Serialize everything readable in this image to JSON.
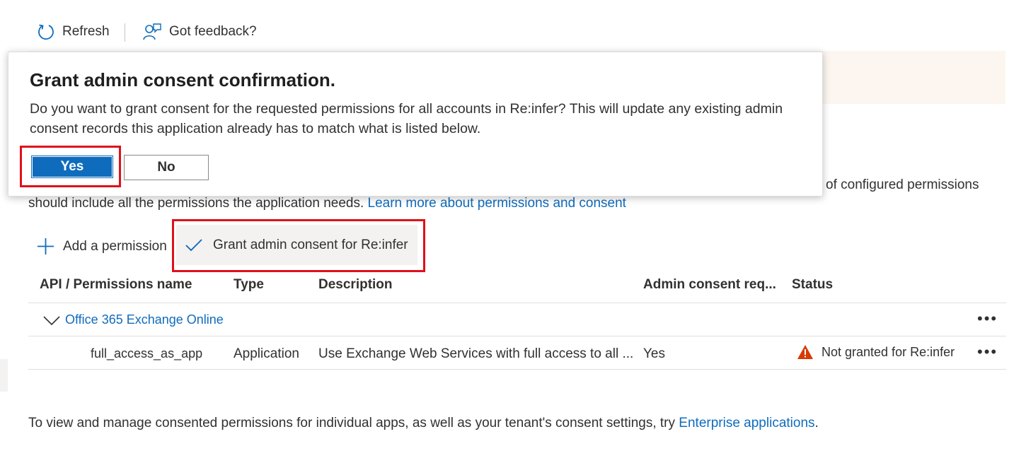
{
  "toolbar": {
    "refresh_label": "Refresh",
    "feedback_label": "Got feedback?"
  },
  "intro": {
    "line1_tail": "of configured permissions",
    "line2": "should include all the permissions the application needs.",
    "learn_more_link": "Learn more about permissions and consent"
  },
  "commands": {
    "add_permission_label": "Add a permission",
    "grant_consent_label": "Grant admin consent for Re:infer"
  },
  "table": {
    "columns": [
      "API / Permissions name",
      "Type",
      "Description",
      "Admin consent req...",
      "Status"
    ],
    "group": {
      "name": "Office 365 Exchange Online"
    },
    "rows": [
      {
        "name": "full_access_as_app",
        "type": "Application",
        "description": "Use Exchange Web Services with full access to all ...",
        "admin_consent": "Yes",
        "status": "Not granted for Re:infer"
      }
    ]
  },
  "footer": {
    "text": "To view and manage consented permissions for individual apps, as well as your tenant's consent settings, try",
    "link": "Enterprise applications",
    "tail": "."
  },
  "dialog": {
    "title": "Grant admin consent confirmation.",
    "message": "Do you want to grant consent for the requested permissions for all accounts in Re:infer? This will update any existing admin consent records this application already has to match what is listed below.",
    "yes_label": "Yes",
    "no_label": "No"
  },
  "colors": {
    "accent": "#0f6cbd",
    "highlight_border": "#e0101a",
    "warning": "#d83b01"
  }
}
